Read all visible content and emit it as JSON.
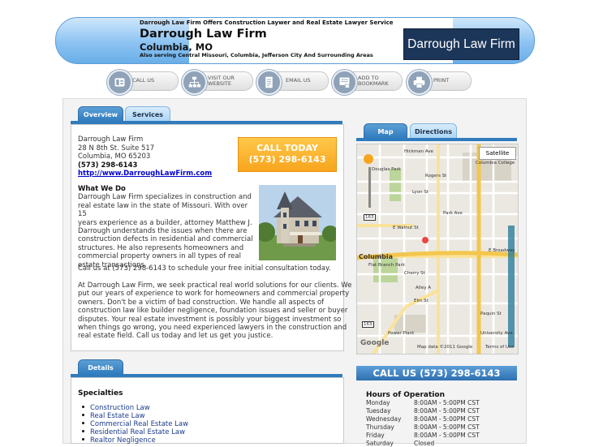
{
  "header": {
    "tagline": "Darrough Law Firm Offers Construction Laywer and Real Estate Lawyer Service",
    "firm_name": "Darrough Law Firm",
    "city": "Columbia, MO",
    "serving": "Also serving Central Missouri, Columbia, Jefferson City And Surrounding Areas",
    "logo_text": "Darrough Law Firm"
  },
  "actions": [
    {
      "label": "CALL US",
      "icon": "phone-icon"
    },
    {
      "label": "VISIT OUR WEBSITE",
      "icon": "sitemap-icon"
    },
    {
      "label": "EMAIL US",
      "icon": "email-icon"
    },
    {
      "label": "ADD TO BOOKMARK",
      "icon": "bookmark-icon"
    },
    {
      "label": "PRINT",
      "icon": "printer-icon"
    }
  ],
  "tabs": {
    "overview": "Overview",
    "services": "Services",
    "map": "Map",
    "directions": "Directions",
    "details": "Details"
  },
  "contact": {
    "name": "Darrough Law Firm",
    "street": "28 N 8th St. Suite 517",
    "city_zip": "Columbia, MO 65203",
    "phone": "(573) 298-6143",
    "website": "http://www.DarroughLawFirm.com"
  },
  "call_today": {
    "line1": "CALL TODAY",
    "line2": "(573) 298-6143"
  },
  "what_we_do": {
    "heading": "What We Do",
    "p1_lines": [
      "Darrough Law Firm specializes in construction and",
      "real estate law in the state of Missouri. With over 15",
      "years experience as a builder, attorney Matthew J.",
      "Darrough understands the issues when there are",
      "construction defects in residential and commercial",
      "structures. He also represents homeowners and",
      "commercial property owners in all types of real",
      "estate transactions."
    ],
    "p2": "Call us at (573) 298-6143 to schedule your free initial consultation today.",
    "p3_lines": [
      "At Darrough Law Firm, we seek practical real world solutions for our clients. We",
      "put our years of experience to work for homeowners and commercial property",
      "owners. Don't be a victim of bad construction. We handle all aspects of",
      "construction law like builder negligence, foundation issues and seller or buyer",
      "disputes. Your real estate investment is possibly your biggest investment so",
      "when things go wrong, you need experienced lawyers in the construction and",
      "real estate field. Call us today and let us get you justice."
    ]
  },
  "map": {
    "satellite": "Satellite",
    "labels": [
      "Hickman Ave",
      "Douglas Park",
      "Rogers St",
      "Lyon St",
      "Park Ave",
      "E Walnut St",
      "Columbia",
      "Flat Branch Park",
      "Cherry St",
      "Alley A",
      "Elm St",
      "Paquin St",
      "University Ave",
      "Power Plant",
      "Columbia College",
      "E Broadway",
      "163",
      "163"
    ],
    "copyright": "Map data ©2011 Google",
    "terms": "Terms of Use",
    "brand": "Google"
  },
  "call_us_bar": "CALL US (573) 298-6143",
  "specialties": {
    "title": "Specialties",
    "items": [
      "Construction Law",
      "Real Estate Law",
      "Commercial Real Estate Law",
      "Residential Real Estate Law",
      "Realtor Negligence"
    ]
  },
  "hours": {
    "title": "Hours of Operation",
    "rows": [
      {
        "day": "Monday",
        "time": "8:00AM - 5:00PM CST"
      },
      {
        "day": "Tuesday",
        "time": "8:00AM - 5:00PM CST"
      },
      {
        "day": "Wednesday",
        "time": "8:00AM - 5:00PM CST"
      },
      {
        "day": "Thursday",
        "time": "8:00AM - 5:00PM CST"
      },
      {
        "day": "Friday",
        "time": "8:00AM - 5:00PM CST"
      },
      {
        "day": "Saturday",
        "time": "Closed"
      }
    ]
  }
}
